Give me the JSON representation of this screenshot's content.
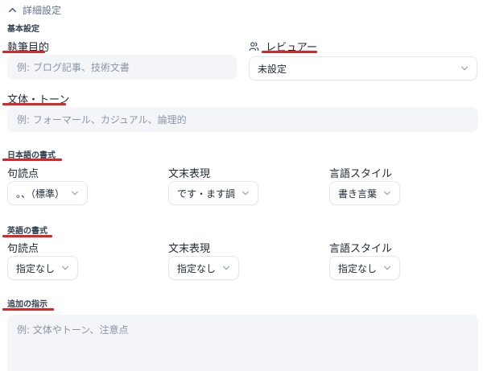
{
  "details_toggle": "詳細設定",
  "basic": {
    "heading": "基本設定",
    "writing_purpose": {
      "label": "執筆目的",
      "placeholder": "例: ブログ記事、技術文書"
    },
    "reviewer": {
      "label": "レビュアー",
      "value": "未設定"
    },
    "style_tone": {
      "label": "文体・トーン",
      "placeholder": "例: フォーマール、カジュアル、論理的"
    }
  },
  "japanese_format": {
    "heading": "日本語の書式",
    "punctuation": {
      "label": "句読点",
      "value": "。、（標準）"
    },
    "sentence_ending": {
      "label": "文末表現",
      "value": "です・ます調"
    },
    "language_style": {
      "label": "言語スタイル",
      "value": "書き言葉"
    }
  },
  "english_format": {
    "heading": "英語の書式",
    "punctuation": {
      "label": "句読点",
      "value": "指定なし"
    },
    "sentence_ending": {
      "label": "文末表現",
      "value": "指定なし"
    },
    "language_style": {
      "label": "言語スタイル",
      "value": "指定なし"
    }
  },
  "additional": {
    "heading": "追加の指示",
    "placeholder": "例: 文体やトーン、注意点"
  },
  "colors": {
    "accent_underline": "#dc2626",
    "input_bg": "#f3f5f9",
    "muted_text": "#8a95a6"
  }
}
